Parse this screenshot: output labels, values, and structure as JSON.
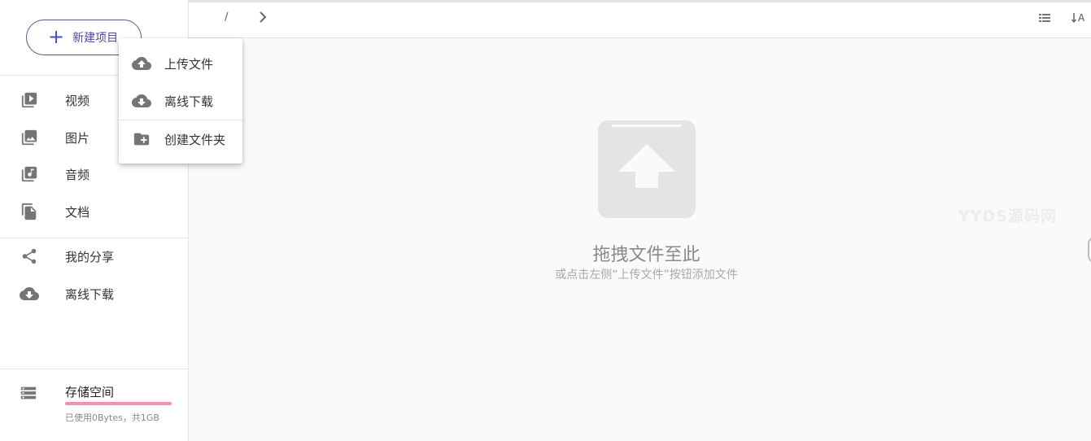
{
  "new_button": {
    "label": "新建项目",
    "icon": "plus-icon"
  },
  "sidebar": {
    "items": [
      {
        "label": "视频",
        "icon": "video-library-icon"
      },
      {
        "label": "图片",
        "icon": "photo-library-icon"
      },
      {
        "label": "音频",
        "icon": "music-library-icon"
      },
      {
        "label": "文档",
        "icon": "document-copy-icon"
      },
      {
        "label": "我的分享",
        "icon": "share-icon"
      },
      {
        "label": "离线下载",
        "icon": "cloud-download-icon"
      }
    ],
    "storage": {
      "title": "存储空间",
      "info": "已使用0Bytes，共1GB",
      "used_fraction": 0.0,
      "bar_color": "#f48fb1",
      "icon": "storage-icon"
    }
  },
  "toolbar": {
    "breadcrumb_root": "/",
    "view_icon": "list-view-icon",
    "sort_icon": "sort-icon",
    "sort_label": "A"
  },
  "dropzone": {
    "title": "拖拽文件至此",
    "subtitle": "或点击左侧“上传文件”按钮添加文件",
    "icon": "upload-box-icon"
  },
  "watermark": "YYDS源码网",
  "menu": {
    "items": [
      {
        "label": "上传文件",
        "icon": "cloud-upload-icon"
      },
      {
        "label": "离线下载",
        "icon": "cloud-download-icon"
      },
      {
        "label": "创建文件夹",
        "icon": "create-folder-icon"
      }
    ]
  },
  "colors": {
    "accent": "#3f51b5",
    "icon_gray": "#757575",
    "storage_bar": "#f48fb1"
  }
}
